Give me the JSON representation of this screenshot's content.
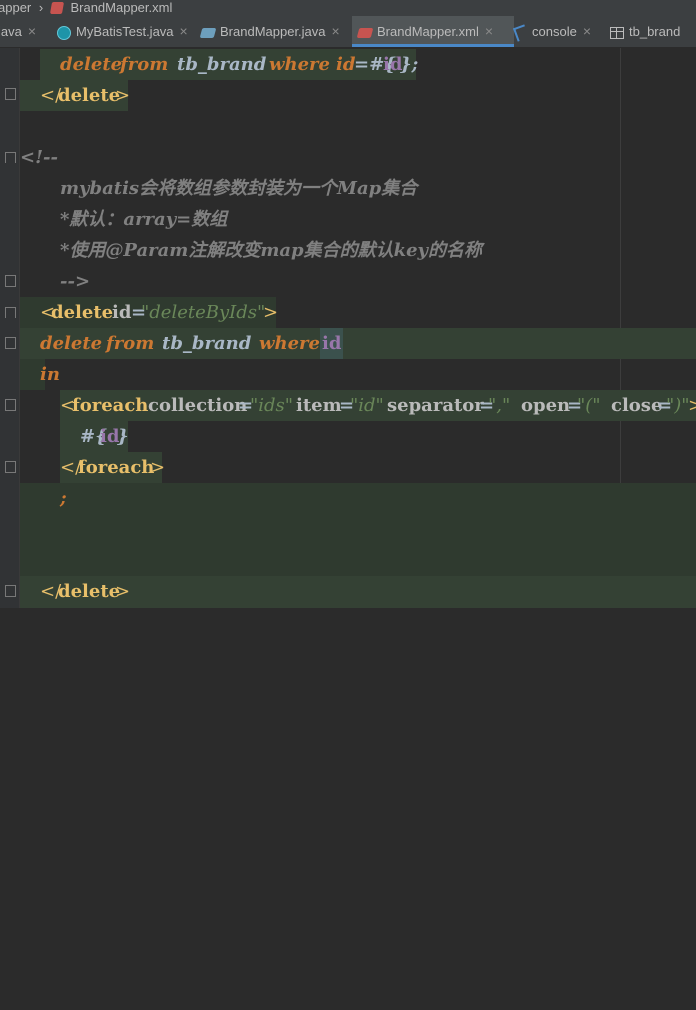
{
  "breadcrumb": {
    "prev": "apper",
    "sep": "›",
    "file": "BrandMapper.xml"
  },
  "tabs": [
    {
      "label": "java",
      "icon": "java-file-icon"
    },
    {
      "label": "MyBatisTest.java",
      "icon": "java-class-icon"
    },
    {
      "label": "BrandMapper.java",
      "icon": "mapper-java-icon"
    },
    {
      "label": "BrandMapper.xml",
      "icon": "mapper-xml-icon",
      "active": true
    },
    {
      "label": "console",
      "icon": "console-icon"
    },
    {
      "label": "tb_brand",
      "icon": "table-icon"
    }
  ],
  "close_glyph": "×",
  "code": {
    "l1": {
      "delete": "delete",
      "from": "from",
      "table": "tb_brand",
      "where": "where",
      "col": "id",
      "eq": "=#{",
      "param": "id",
      "end": "};"
    },
    "l2": {
      "open": "</",
      "tag": "delete",
      "close": ">"
    },
    "l4": {
      "text": "<!--"
    },
    "l5": {
      "text": "mybatis会将数组参数封装为一个Map集合"
    },
    "l6": {
      "text": "*默认：array=数组"
    },
    "l7": {
      "text": "*使用@Param注解改变map集合的默认key的名称"
    },
    "l8": {
      "text": "-->"
    },
    "l9": {
      "lt": "<",
      "tag": "delete",
      "attr": "id",
      "eq": "=",
      "val": "\"deleteByIds\"",
      "gt": ">"
    },
    "l10": {
      "delete": "delete",
      "from": "from",
      "table": "tb_brand",
      "where": "where",
      "col": "id"
    },
    "l11": {
      "kw": "in"
    },
    "l12": {
      "lt": "<",
      "tag": "foreach",
      "a1": "collection",
      "v1": "\"ids\"",
      "a2": "item",
      "v2": "\"id\"",
      "a3": "separator",
      "v3": "\",\"",
      "a4": "open",
      "v4": "\"(\"",
      "a5": "close",
      "v5": "\")\"",
      "gt": ">",
      "eq": "="
    },
    "l13": {
      "hash": "#{",
      "param": "id",
      "end": "}"
    },
    "l14": {
      "open": "</",
      "tag": "foreach",
      "close": ">"
    },
    "l15": {
      "semi": ";"
    },
    "l18": {
      "open": "</",
      "tag": "delete",
      "close": ">"
    }
  }
}
